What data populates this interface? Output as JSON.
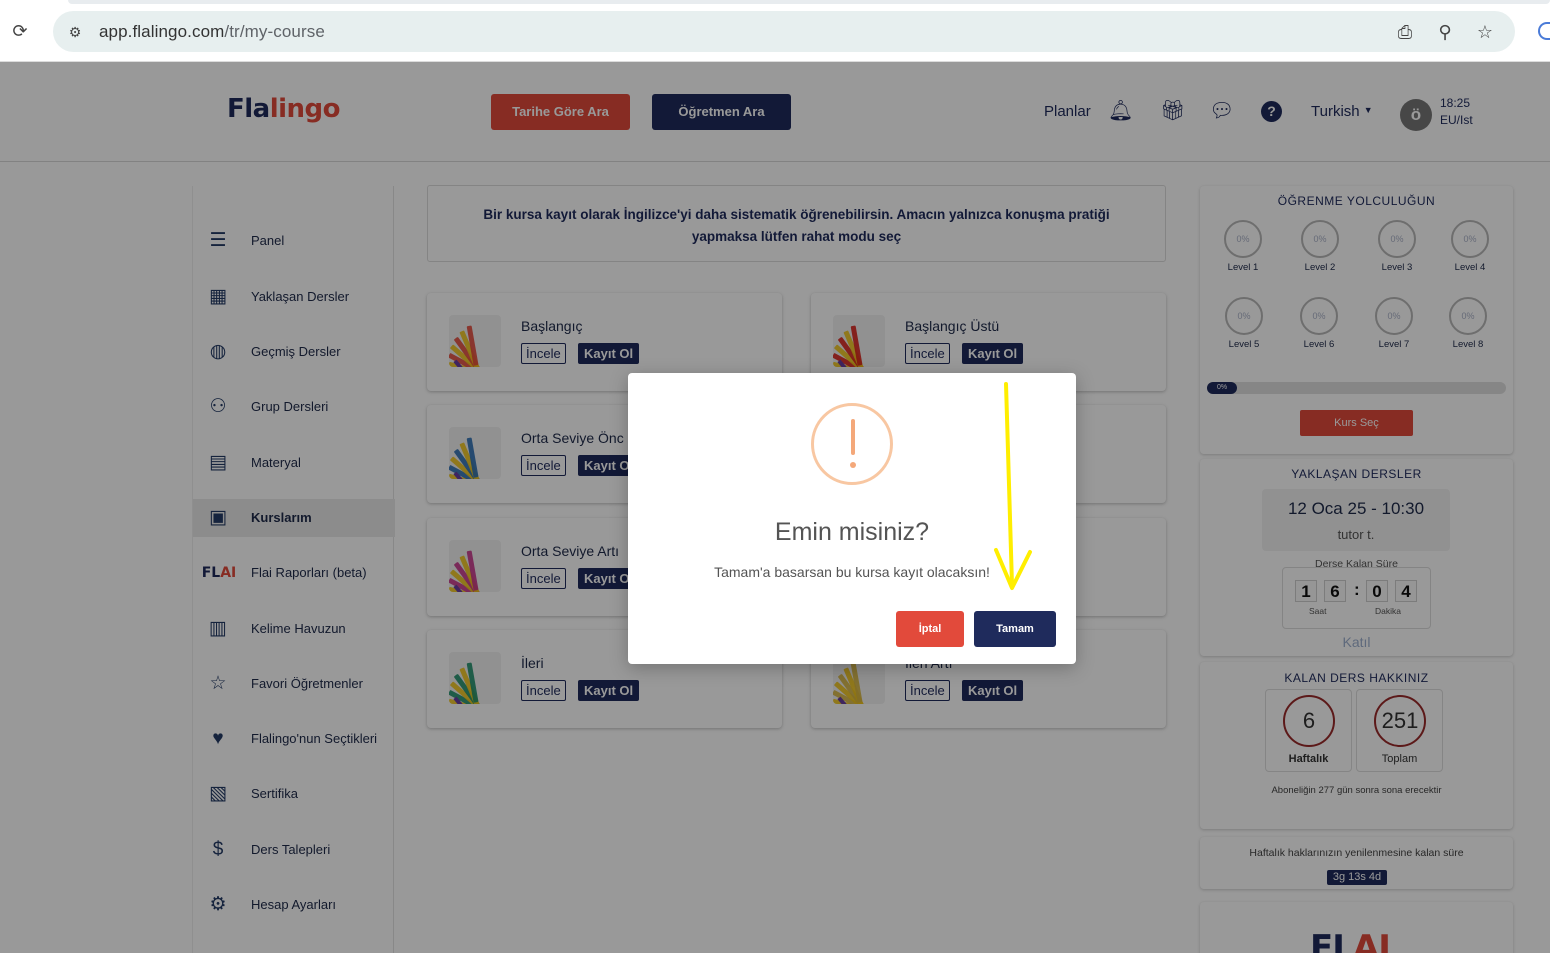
{
  "browser": {
    "url_host": "app.flalingo.com",
    "url_path": "/tr/my-course"
  },
  "header": {
    "logo_part1": "Fla",
    "logo_part2": "lingo",
    "btn_date": "Tarihe Göre Ara",
    "btn_teacher": "Öğretmen Ara",
    "plans": "Planlar",
    "language": "Turkish",
    "avatar_initial": "ö",
    "time": "18:25",
    "timezone": "EU/Ist"
  },
  "sidebar": {
    "items": [
      {
        "label": "Panel",
        "icon": "panel-icon"
      },
      {
        "label": "Yaklaşan Dersler",
        "icon": "upcoming-lessons-icon"
      },
      {
        "label": "Geçmiş Dersler",
        "icon": "past-lessons-icon"
      },
      {
        "label": "Grup Dersleri",
        "icon": "group-lessons-icon"
      },
      {
        "label": "Materyal",
        "icon": "material-icon"
      },
      {
        "label": "Kurslarım",
        "icon": "my-courses-icon",
        "active": true
      },
      {
        "label": "Flai Raporları (beta)",
        "icon": "flai-logo-icon",
        "brand1": "FL",
        "brand2": "AI"
      },
      {
        "label": "Kelime Havuzun",
        "icon": "word-pool-icon"
      },
      {
        "label": "Favori Öğretmenler",
        "icon": "favorite-teachers-icon"
      },
      {
        "label": "Flalingo'nun Seçtikleri",
        "icon": "picks-icon"
      },
      {
        "label": "Sertifika",
        "icon": "certificate-icon"
      },
      {
        "label": "Ders Talepleri",
        "icon": "lesson-requests-icon"
      },
      {
        "label": "Hesap Ayarları",
        "icon": "account-settings-icon"
      }
    ]
  },
  "info_text": "Bir kursa kayıt olarak İngilizce'yi daha sistematik öğrenebilirsin. Amacın yalnızca konuşma pratiği yapmaksa lütfen rahat modu seç",
  "courses": [
    {
      "title": "Başlangıç",
      "review": "İncele",
      "enroll": "Kayıt Ol",
      "color": "#e24a3b"
    },
    {
      "title": "Başlangıç Üstü",
      "review": "İncele",
      "enroll": "Kayıt Ol",
      "color": "#d9241c"
    },
    {
      "title": "Orta Seviye Önc",
      "review": "İncele",
      "enroll": "Kayıt O",
      "color": "#2c6fb3"
    },
    {
      "title": "",
      "review": "",
      "enroll": "",
      "color": "#2c6fb3"
    },
    {
      "title": "Orta Seviye Artı",
      "review": "İncele",
      "enroll": "Kayıt O",
      "color": "#c7348b"
    },
    {
      "title": "",
      "review": "",
      "enroll": "",
      "color": "#c7348b"
    },
    {
      "title": "İleri",
      "review": "İncele",
      "enroll": "Kayıt Ol",
      "color": "#1f8f6a"
    },
    {
      "title": "İleri Artı",
      "review": "İncele",
      "enroll": "Kayıt Ol",
      "color": "#d8b640"
    }
  ],
  "journey": {
    "title": "ÖĞRENME YOLCULUĞUN",
    "levels": [
      {
        "label": "Level 1",
        "pct": "0%"
      },
      {
        "label": "Level 2",
        "pct": "0%"
      },
      {
        "label": "Level 3",
        "pct": "0%"
      },
      {
        "label": "Level 4",
        "pct": "0%"
      },
      {
        "label": "Level 5",
        "pct": "0%"
      },
      {
        "label": "Level 6",
        "pct": "0%"
      },
      {
        "label": "Level 7",
        "pct": "0%"
      },
      {
        "label": "Level 8",
        "pct": "0%"
      }
    ],
    "progress": "0%",
    "btn": "Kurs Seç"
  },
  "upcoming": {
    "title": "YAKLAŞAN DERSLER",
    "date": "12 Oca 25 - 10:30",
    "tutor": "tutor t.",
    "remaining_label": "Derse Kalan Süre",
    "digits": [
      "1",
      "6",
      "0",
      "4"
    ],
    "hours_label": "Saat",
    "minutes_label": "Dakika",
    "join": "Katıl"
  },
  "credits": {
    "title": "KALAN DERS HAKKINIZ",
    "weekly_value": "6",
    "weekly_label": "Haftalık",
    "total_value": "251",
    "total_label": "Toplam",
    "note": "Aboneliğin 277 gün sonra sona erecektir"
  },
  "renewal": {
    "text": "Haftalık haklarınızın yenilenmesine kalan süre",
    "value": "3g 13s 4d"
  },
  "flai_bottom": {
    "part1": "FL",
    "part2": "AI"
  },
  "modal": {
    "title": "Emin misiniz?",
    "text": "Tamam'a basarsan bu kursa kayıt olacaksın!",
    "cancel": "İptal",
    "ok": "Tamam"
  },
  "colors": {
    "navy": "#1f2b5c",
    "red": "#e24a3b",
    "warning": "#f4a87a",
    "annotation": "#ffee00"
  }
}
